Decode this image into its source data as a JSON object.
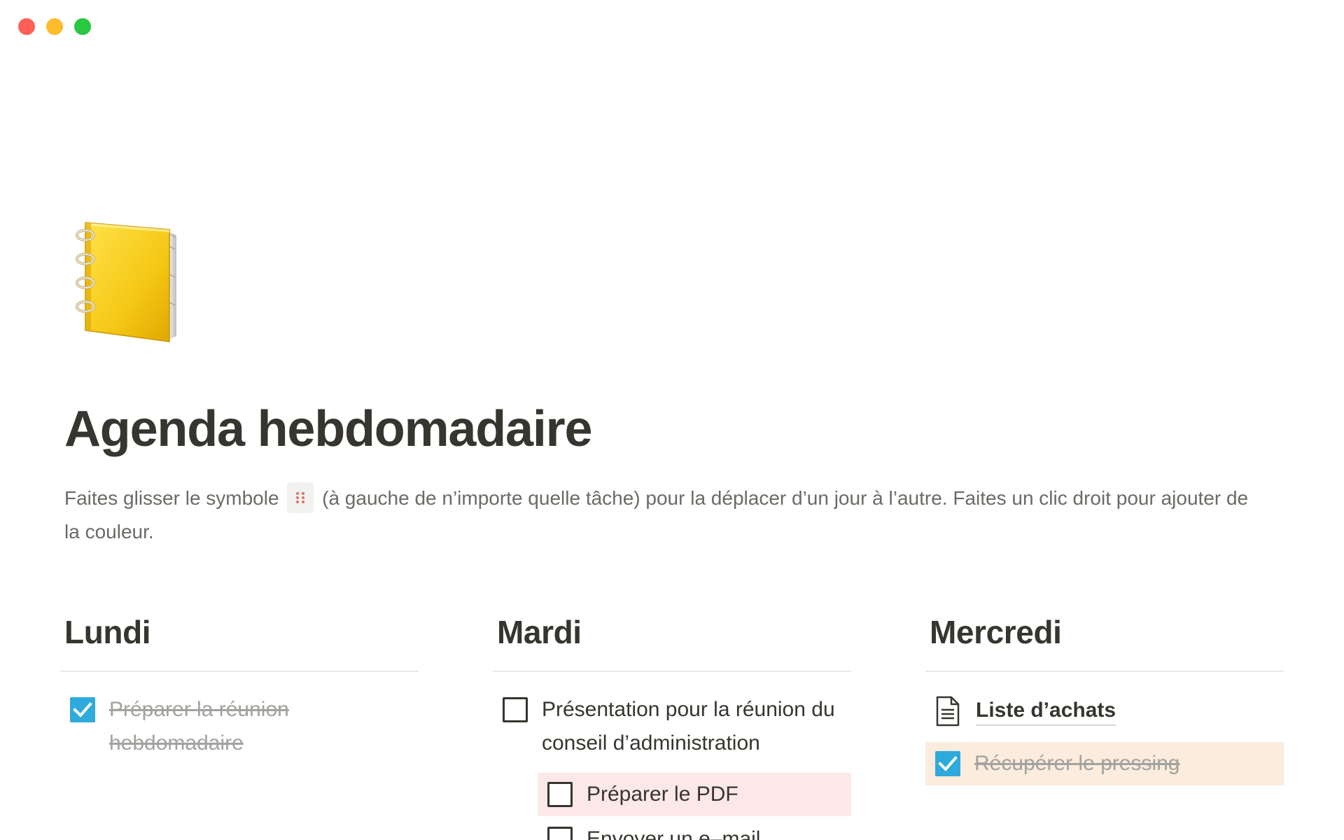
{
  "window": {
    "controls": [
      "close",
      "minimize",
      "zoom"
    ]
  },
  "page": {
    "icon": "notebook-icon",
    "title": "Agenda hebdomadaire",
    "description_before": "Faites glisser le symbole",
    "description_after": "(à gauche de n’importe quelle tâche) pour la déplacer d’un jour à l’autre. Faites un clic droit pour ajouter de la couleur.",
    "drag_handle_icon": "drag-handle-icon"
  },
  "columns": [
    {
      "heading": "Lundi",
      "items": [
        {
          "type": "todo",
          "label": "Préparer la réunion hebdomadaire",
          "checked": true
        }
      ]
    },
    {
      "heading": "Mardi",
      "items": [
        {
          "type": "todo",
          "label": "Présentation pour la réunion du conseil d’administration",
          "checked": false
        },
        {
          "type": "todo",
          "label": "Préparer le PDF",
          "checked": false,
          "indent": 1,
          "color": "#fde8e8"
        },
        {
          "type": "todo",
          "label": "Envoyer un e–mail",
          "checked": false,
          "indent": 1
        }
      ]
    },
    {
      "heading": "Mercredi",
      "items": [
        {
          "type": "page-link",
          "label": "Liste d’achats",
          "icon": "document-icon"
        },
        {
          "type": "todo",
          "label": "Récupérer le pressing",
          "checked": true,
          "color": "#fbecdd"
        }
      ]
    }
  ],
  "colors": {
    "checkbox_checked": "#2eaadc",
    "text": "#37352f",
    "muted_text": "#6b6a66",
    "done_text": "#a3a29f"
  }
}
